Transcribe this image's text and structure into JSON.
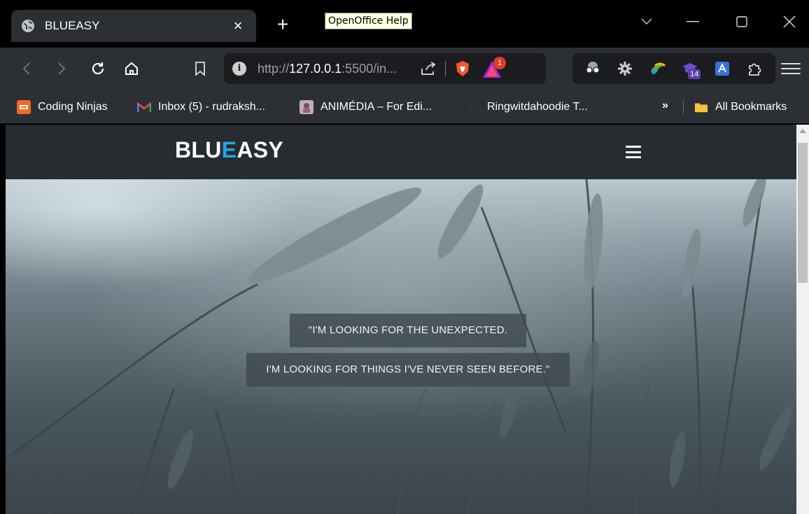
{
  "browser": {
    "tab": {
      "title": "BLUEASY",
      "close_label": "×"
    },
    "new_tab_label": "+",
    "tooltip": "OpenOffice Help",
    "url": {
      "prefix": "http://",
      "host": "127.0.0.1",
      "rest": ":5500/in..."
    },
    "rewards_badge": "1",
    "extension_count": "14",
    "bookmarks": [
      {
        "label": "Coding Ninjas",
        "icon": "coding-ninjas-icon",
        "color": "#f26a21"
      },
      {
        "label": "Inbox (5) - rudraksh...",
        "icon": "gmail-icon",
        "color": "#ea4335"
      },
      {
        "label": "ANIMÉDIA – For Edi...",
        "icon": "animedia-icon",
        "color": "#c9a9b2"
      },
      {
        "label": "Ringwitdahoodie T...",
        "icon": "ringwitdahoodie-icon",
        "color": "#333333"
      }
    ],
    "bookmarks_more": "»",
    "all_bookmarks": "All Bookmarks"
  },
  "site": {
    "logo_part1": "BLU",
    "logo_accent": "E",
    "logo_part2": "ASY",
    "accent_color": "#29a3e2",
    "hero_quote_line1": "\"I'M LOOKING FOR THE UNEXPECTED.",
    "hero_quote_line2": "I'M LOOKING FOR THINGS I'VE NEVER SEEN BEFORE.\""
  }
}
